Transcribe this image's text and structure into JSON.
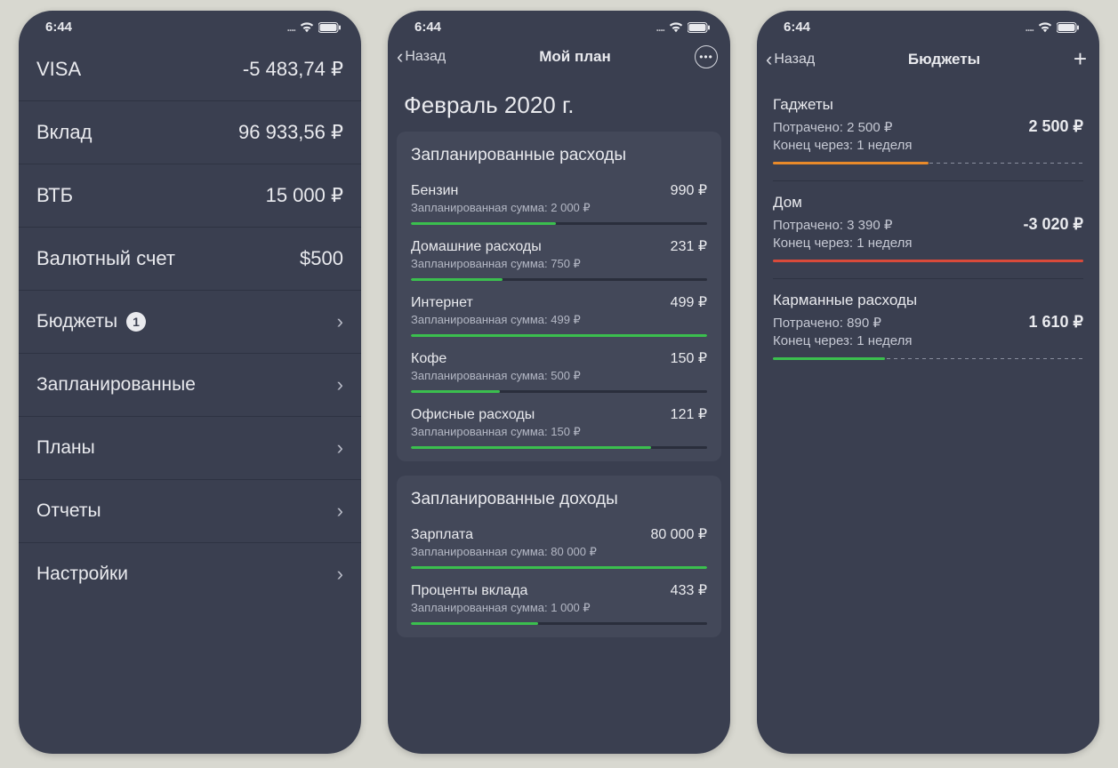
{
  "status": {
    "time": "6:44"
  },
  "screen1": {
    "accounts": [
      {
        "name": "VISA",
        "value": "-5 483,74 ₽"
      },
      {
        "name": "Вклад",
        "value": "96 933,56 ₽"
      },
      {
        "name": "ВТБ",
        "value": "15 000 ₽"
      },
      {
        "name": "Валютный счет",
        "value": "$500"
      }
    ],
    "menu": {
      "budgets": "Бюджеты",
      "budgets_badge": "1",
      "planned": "Запланированные",
      "plans": "Планы",
      "reports": "Отчеты",
      "settings": "Настройки"
    }
  },
  "screen2": {
    "back": "Назад",
    "title": "Мой план",
    "month": "Февраль 2020 г.",
    "expenses_title": "Запланированные расходы",
    "planned_label": "Запланированная сумма:",
    "expenses": [
      {
        "name": "Бензин",
        "planned": "2 000 ₽",
        "actual": "990 ₽",
        "pct": 49
      },
      {
        "name": "Домашние расходы",
        "planned": "750 ₽",
        "actual": "231 ₽",
        "pct": 31
      },
      {
        "name": "Интернет",
        "planned": "499 ₽",
        "actual": "499 ₽",
        "pct": 100
      },
      {
        "name": "Кофе",
        "planned": "500 ₽",
        "actual": "150 ₽",
        "pct": 30
      },
      {
        "name": "Офисные расходы",
        "planned": "150 ₽",
        "actual": "121 ₽",
        "pct": 81
      }
    ],
    "income_title": "Запланированные доходы",
    "income": [
      {
        "name": "Зарплата",
        "planned": "80 000 ₽",
        "actual": "80 000 ₽",
        "pct": 100
      },
      {
        "name": "Проценты вклада",
        "planned": "1 000 ₽",
        "actual": "433 ₽",
        "pct": 43
      }
    ]
  },
  "screen3": {
    "back": "Назад",
    "title": "Бюджеты",
    "spent_label": "Потрачено:",
    "ends_label": "Конец через:",
    "items": [
      {
        "name": "Гаджеты",
        "spent": "2 500 ₽",
        "remaining": "2 500 ₽",
        "ends": "1 неделя",
        "pct": 50,
        "color": "orange"
      },
      {
        "name": "Дом",
        "spent": "3 390 ₽",
        "remaining": "-3 020 ₽",
        "ends": "1 неделя",
        "pct": 100,
        "color": "red"
      },
      {
        "name": "Карманные расходы",
        "spent": "890 ₽",
        "remaining": "1 610 ₽",
        "ends": "1 неделя",
        "pct": 36,
        "color": "green"
      }
    ]
  }
}
